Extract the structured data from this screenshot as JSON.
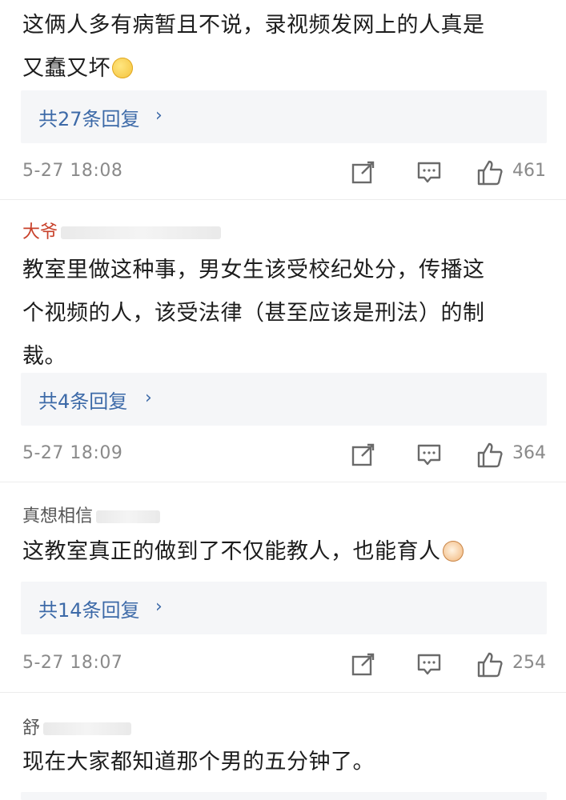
{
  "comments": [
    {
      "author": "",
      "text_lines": [
        "这俩人多有病暂且不说，录视频发网上的人真是",
        "又蠢又坏"
      ],
      "emoji": "thinking-emoji",
      "replies_label": "共27条回复",
      "time": "5-27 18:08",
      "likes": "461"
    },
    {
      "author": "大爷",
      "text_lines": [
        "教室里做这种事，男女生该受校纪处分，传播这",
        "个视频的人，该受法律（甚至应该是刑法）的制",
        "裁。"
      ],
      "emoji": "",
      "replies_label": "共4条回复",
      "time": "5-27 18:09",
      "likes": "364"
    },
    {
      "author": "真想相信",
      "text_lines": [
        "这教室真正的做到了不仅能教人，也能育人"
      ],
      "emoji": "cat-emoji",
      "replies_label": "共14条回复",
      "time": "5-27 18:07",
      "likes": "254"
    },
    {
      "author": "舒",
      "text_lines": [
        "现在大家都知道那个男的五分钟了。"
      ],
      "emoji": "",
      "replies_label": "",
      "time": "",
      "likes": ""
    }
  ],
  "colors": {
    "link": "#3d6aa8",
    "meta": "#8a8a8a",
    "reply_bg": "#f5f6f8",
    "icon_stroke": "#6a6a6a"
  },
  "icons": {
    "share": "share-icon",
    "comment": "comment-icon",
    "like": "thumbs-up-icon",
    "chevron": "chevron-right-icon"
  }
}
